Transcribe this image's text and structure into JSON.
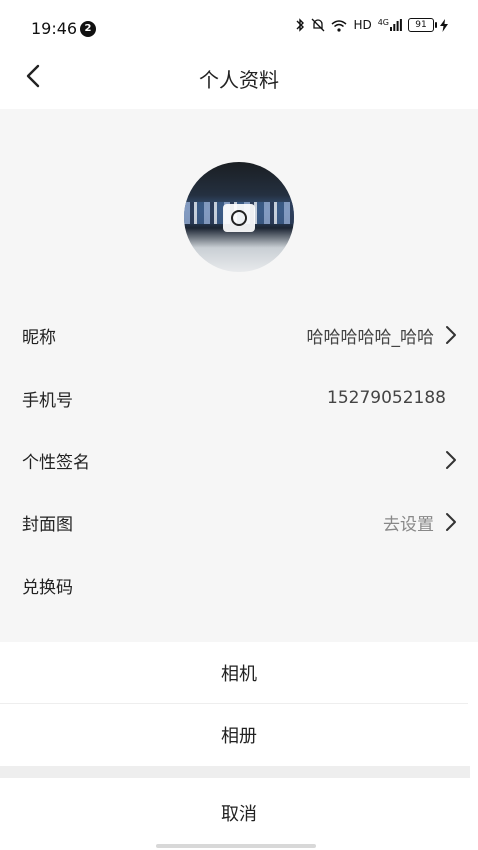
{
  "status_bar": {
    "time": "19:46",
    "notification_count": "2",
    "network": "HD",
    "signal": "4G",
    "battery": "91"
  },
  "header": {
    "title": "个人资料"
  },
  "profile": {
    "rows": [
      {
        "label": "昵称",
        "value": "哈哈哈哈哈_哈哈"
      },
      {
        "label": "手机号",
        "value": "15279052188"
      },
      {
        "label": "个性签名",
        "value": ""
      },
      {
        "label": "封面图",
        "value": "去设置"
      },
      {
        "label": "兑换码",
        "value": ""
      }
    ]
  },
  "action_sheet": {
    "camera": "相机",
    "album": "相册",
    "cancel": "取消"
  }
}
